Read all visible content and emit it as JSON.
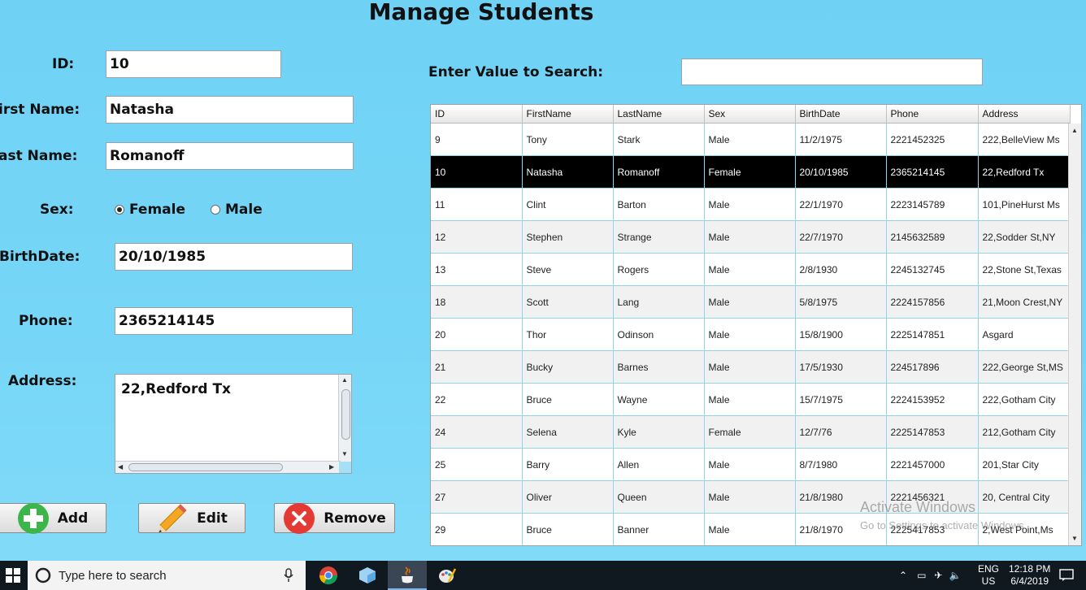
{
  "title": "Manage Students",
  "form": {
    "id_label": "ID:",
    "id_value": "10",
    "first_name_label": "irst Name:",
    "first_name_value": "Natasha",
    "last_name_label": "ast Name:",
    "last_name_value": "Romanoff",
    "sex_label": "Sex:",
    "sex_options": [
      "Female",
      "Male"
    ],
    "sex_selected": "Female",
    "birthdate_label": "BirthDate:",
    "birthdate_value": "20/10/1985",
    "phone_label": "Phone:",
    "phone_value": "2365214145",
    "address_label": "Address:",
    "address_value": "22,Redford Tx"
  },
  "buttons": {
    "add": "Add",
    "edit": "Edit",
    "remove": "Remove"
  },
  "search": {
    "label": "Enter Value to Search:",
    "value": ""
  },
  "table": {
    "columns": [
      "ID",
      "FirstName",
      "LastName",
      "Sex",
      "BirthDate",
      "Phone",
      "Address"
    ],
    "selected_id": "10",
    "rows": [
      [
        "9",
        "Tony",
        "Stark",
        "Male",
        "11/2/1975",
        "2221452325",
        "222,BelleView Ms"
      ],
      [
        "10",
        "Natasha",
        "Romanoff",
        "Female",
        "20/10/1985",
        "2365214145",
        "22,Redford Tx"
      ],
      [
        "11",
        "Clint",
        "Barton",
        "Male",
        "22/1/1970",
        "2223145789",
        "101,PineHurst Ms"
      ],
      [
        "12",
        "Stephen",
        "Strange",
        "Male",
        "22/7/1970",
        "2145632589",
        "22,Sodder St,NY"
      ],
      [
        "13",
        "Steve",
        "Rogers",
        "Male",
        "2/8/1930",
        "2245132745",
        "22,Stone St,Texas"
      ],
      [
        "18",
        "Scott",
        "Lang",
        "Male",
        "5/8/1975",
        "2224157856",
        "21,Moon Crest,NY"
      ],
      [
        "20",
        "Thor",
        "Odinson",
        "Male",
        "15/8/1900",
        "2225147851",
        "Asgard"
      ],
      [
        "21",
        "Bucky",
        "Barnes",
        "Male",
        "17/5/1930",
        "224517896",
        "222,George St,MS"
      ],
      [
        "22",
        "Bruce",
        "Wayne",
        "Male",
        "15/7/1975",
        "2224153952",
        "222,Gotham City"
      ],
      [
        "24",
        "Selena",
        "Kyle",
        "Female",
        "12/7/76",
        "2225147853",
        "212,Gotham City"
      ],
      [
        "25",
        "Barry",
        "Allen",
        "Male",
        "8/7/1980",
        "2221457000",
        "201,Star City"
      ],
      [
        "27",
        "Oliver",
        "Queen",
        "Male",
        "21/8/1980",
        "2221456321",
        "20, Central City"
      ],
      [
        "29",
        "Bruce",
        "Banner",
        "Male",
        "21/8/1970",
        "2225417853",
        "2,West Point,Ms"
      ]
    ]
  },
  "watermark": {
    "line1": "Activate Windows",
    "line2": "Go to Settings to activate Windows."
  },
  "taskbar": {
    "search_placeholder": "Type here to search",
    "language": "ENG",
    "region": "US",
    "time": "12:18 PM",
    "date": "6/4/2019"
  }
}
